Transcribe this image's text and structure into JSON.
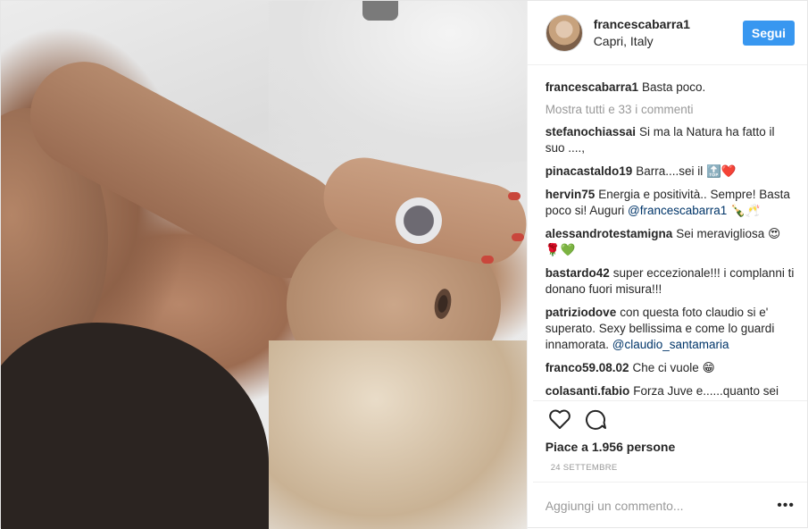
{
  "header": {
    "username": "francescabarra1",
    "location": "Capri, Italy",
    "follow_label": "Segui"
  },
  "caption": {
    "user": "francescabarra1",
    "text": "Basta poco."
  },
  "show_all_comments": "Mostra tutti e 33 i commenti",
  "comments": [
    {
      "user": "stefanochiassai",
      "text": "Si ma la Natura ha fatto il suo ....,"
    },
    {
      "user": "pinacastaldo19",
      "text": "Barra....sei il",
      "emoji": "🔝❤️"
    },
    {
      "user": "hervin75",
      "text": "Energia e positività.. Sempre! Basta poco si! Auguri",
      "mention": "@francescabarra1",
      "emoji": "🍾🥂"
    },
    {
      "user": "alessandrotestamigna",
      "text": "Sei meravigliosa",
      "emoji": "😍🌹💚"
    },
    {
      "user": "bastardo42",
      "text": "super eccezionale!!! i complanni ti donano fuori misura!!!"
    },
    {
      "user": "patriziodove",
      "text": "con questa foto claudio si e' superato. Sexy bellissima e come lo guardi innamorata.",
      "mention": "@claudio_santamaria"
    },
    {
      "user": "franco59.08.02",
      "text": "Che ci vuole",
      "emoji": "😁"
    },
    {
      "user": "colasanti.fabio",
      "text": "Forza Juve e......quanto sei"
    }
  ],
  "likes": "Piace a 1.956 persone",
  "date": "24 SETTEMBRE",
  "add_comment": {
    "placeholder": "Aggiungi un commento..."
  },
  "icons": {
    "like": "heart-icon",
    "comment": "comment-bubble-icon",
    "more": "more-options-icon"
  }
}
